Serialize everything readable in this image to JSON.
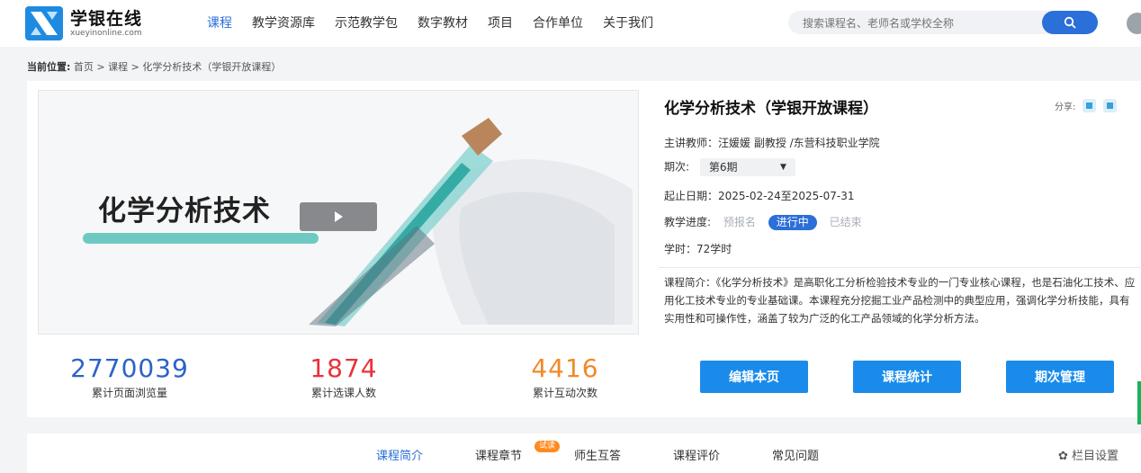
{
  "header": {
    "logo_title": "学银在线",
    "logo_subtitle": "xueyinonline.com",
    "nav": [
      "课程",
      "教学资源库",
      "示范教学包",
      "数字教材",
      "项目",
      "合作单位",
      "关于我们"
    ],
    "active_nav": "课程",
    "search_placeholder": "搜索课程名、老师名或学校全称"
  },
  "breadcrumb": {
    "label": "当前位置:",
    "path": "首页 > 课程 > 化学分析技术（学银开放课程）"
  },
  "video": {
    "overlay_title": "化学分析技术"
  },
  "stats": [
    {
      "value": "2770039",
      "label": "累计页面浏览量",
      "color": "#2b63c8"
    },
    {
      "value": "1874",
      "label": "累计选课人数",
      "color": "#e8323c"
    },
    {
      "value": "4416",
      "label": "累计互动次数",
      "color": "#f08a2a"
    }
  ],
  "course": {
    "title": "化学分析技术（学银开放课程）",
    "share_label": "分享:",
    "teacher": "主讲教师：汪媛媛 副教授 /东营科技职业学院",
    "term_label": "期次:",
    "term_value": "第6期",
    "dates": "起止日期：2025-02-24至2025-07-31",
    "progress_label": "教学进度:",
    "progress_states": [
      "预报名",
      "进行中",
      "已结束"
    ],
    "progress_current": "进行中",
    "hours": "学时：72学时",
    "intro": "课程简介：《化学分析技术》是高职化工分析检验技术专业的一门专业核心课程，也是石油化工技术、应用化工技术专业的专业基础课。本课程充分挖掘工业产品检测中的典型应用，强调化学分析技能，具有实用性和可操作性，涵盖了较为广泛的化工产品领域的化学分析方法。"
  },
  "actions": [
    "编辑本页",
    "课程统计",
    "期次管理"
  ],
  "tabs": {
    "items": [
      "课程简介",
      "课程章节",
      "师生互答",
      "课程评价",
      "常见问题"
    ],
    "active": "课程简介",
    "trial_badge": "试读",
    "settings_label": "栏目设置"
  }
}
